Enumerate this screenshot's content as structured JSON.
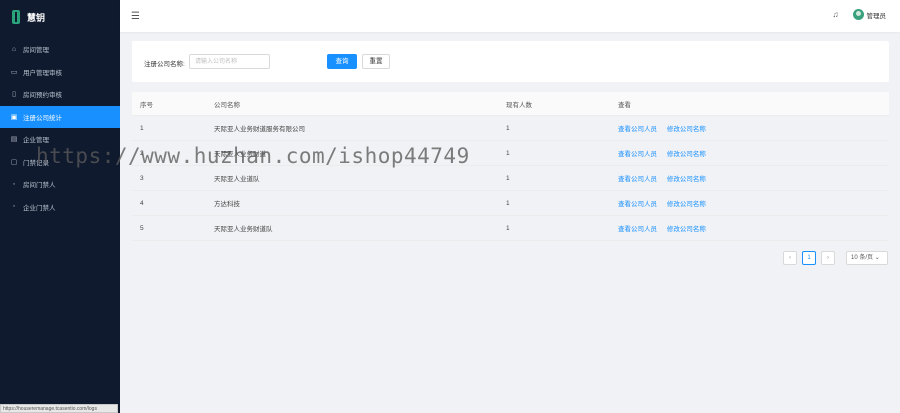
{
  "app": {
    "logo_text": "慧钥"
  },
  "sidebar": {
    "items": [
      {
        "label": "房间管理",
        "icon": "home-icon"
      },
      {
        "label": "用户管理审核",
        "icon": "user-card-icon"
      },
      {
        "label": "房间预约审核",
        "icon": "calendar-icon"
      },
      {
        "label": "注册公司统计",
        "icon": "chart-icon",
        "active": true
      },
      {
        "label": "企业管理",
        "icon": "building-icon"
      },
      {
        "label": "门禁记录",
        "icon": "door-icon"
      },
      {
        "label": "房间门禁人",
        "icon": "key-icon"
      },
      {
        "label": "企业门禁人",
        "icon": "people-icon"
      }
    ]
  },
  "topbar": {
    "username": "管理员"
  },
  "filter": {
    "label": "注册公司名称:",
    "placeholder": "请输入公司名称",
    "query_label": "查询",
    "reset_label": "重置"
  },
  "table": {
    "headers": [
      "序号",
      "公司名称",
      "现有人数",
      "查看"
    ],
    "rows": [
      {
        "index": "1",
        "name": "天际亚人业务财道服务有限公司",
        "count": "1",
        "actions": [
          "查看公司人员",
          "修改公司名称"
        ]
      },
      {
        "index": "2",
        "name": "天际亚人业务财道",
        "count": "1",
        "actions": [
          "查看公司人员",
          "修改公司名称"
        ]
      },
      {
        "index": "3",
        "name": "天际亚人业道队",
        "count": "1",
        "actions": [
          "查看公司人员",
          "修改公司名称"
        ]
      },
      {
        "index": "4",
        "name": "方达科技",
        "count": "1",
        "actions": [
          "查看公司人员",
          "修改公司名称"
        ]
      },
      {
        "index": "5",
        "name": "天际亚人业务财道队",
        "count": "1",
        "actions": [
          "查看公司人员",
          "修改公司名称"
        ]
      }
    ]
  },
  "pagination": {
    "prev": "‹",
    "current": "1",
    "next": "›",
    "page_size": "10 条/页"
  },
  "statusbar": {
    "url": "https://houseremanage.tcasentio.com/logs"
  },
  "watermark": "https://www.huzhan.com/ishop44749",
  "colors": {
    "accent": "#1890ff",
    "sidebar_bg": "#0f1a2e"
  }
}
